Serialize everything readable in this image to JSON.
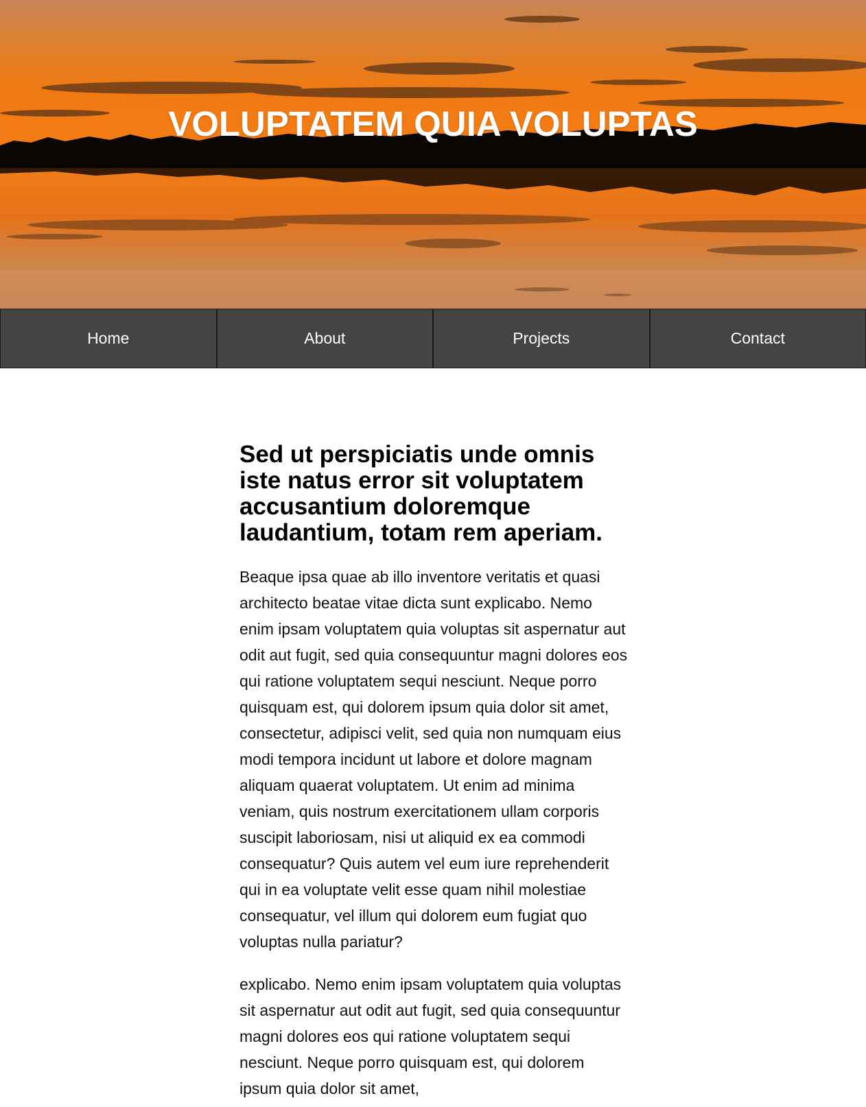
{
  "site": {
    "title": "VOLUPTATEM QUIA VOLUPTAS",
    "hero_image": "sunset-lake-reflection"
  },
  "nav": {
    "items": [
      {
        "label": "Home"
      },
      {
        "label": "About"
      },
      {
        "label": "Projects"
      },
      {
        "label": "Contact"
      }
    ]
  },
  "article": {
    "heading": "Sed ut perspiciatis unde omnis iste natus error sit voluptatem accusantium doloremque laudantium, totam rem aperiam.",
    "paragraphs": [
      "Beaque ipsa quae ab illo inventore veritatis et quasi architecto beatae vitae dicta sunt explicabo. Nemo enim ipsam voluptatem quia voluptas sit aspernatur aut odit aut fugit, sed quia consequuntur magni dolores eos qui ratione voluptatem sequi nesciunt. Neque porro quisquam est, qui dolorem ipsum quia dolor sit amet, consectetur, adipisci velit, sed quia non numquam eius modi tempora incidunt ut labore et dolore magnam aliquam quaerat voluptatem. Ut enim ad minima veniam, quis nostrum exercitationem ullam corporis suscipit laboriosam, nisi ut aliquid ex ea commodi consequatur? Quis autem vel eum iure reprehenderit qui in ea voluptate velit esse quam nihil molestiae consequatur, vel illum qui dolorem eum fugiat quo voluptas nulla pariatur?",
      "explicabo. Nemo enim ipsam voluptatem quia voluptas sit aspernatur aut odit aut fugit, sed quia consequuntur magni dolores eos qui ratione voluptatem sequi nesciunt. Neque porro quisquam est, qui dolorem ipsum quia dolor sit amet,"
    ]
  },
  "colors": {
    "nav_background": "#444444",
    "nav_border": "#1a1a1a",
    "nav_text": "#ffffff",
    "sky_orange": "#e8761c",
    "treeline": "#0a0604"
  }
}
